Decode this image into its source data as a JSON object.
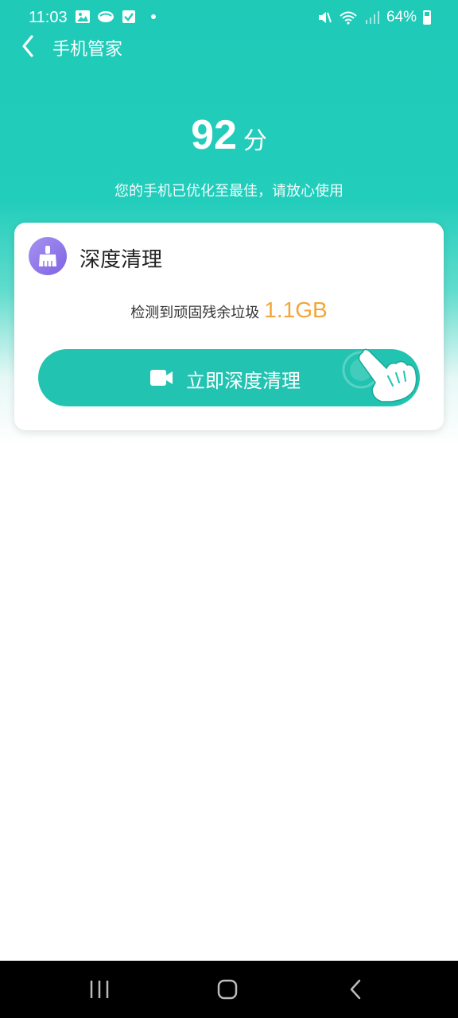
{
  "status_bar": {
    "time": "11:03",
    "battery_text": "64%",
    "icons": [
      "gallery-icon",
      "app-icon",
      "checklist-icon",
      "notification-dot",
      "mute-icon",
      "wifi-icon",
      "signal-icon",
      "battery-icon"
    ]
  },
  "header": {
    "title": "手机管家",
    "back_icon": "chevron-left-icon"
  },
  "score": {
    "value": "92",
    "unit": "分",
    "description": "您的手机已优化至最佳，请放心使用"
  },
  "card": {
    "icon": "broom-icon",
    "title": "深度清理",
    "detect_label": "检测到顽固残余垃圾",
    "detect_value": "1.1GB",
    "button_label": "立即深度清理",
    "button_icon": "video-camera-icon"
  },
  "nav_bar": {
    "buttons": [
      "recents-icon",
      "home-icon",
      "back-icon"
    ]
  },
  "colors": {
    "primary": "#22c3b1",
    "hero": "#1fcab7",
    "accent_value": "#f2a63a",
    "icon_purple": "#8a6fe6"
  }
}
